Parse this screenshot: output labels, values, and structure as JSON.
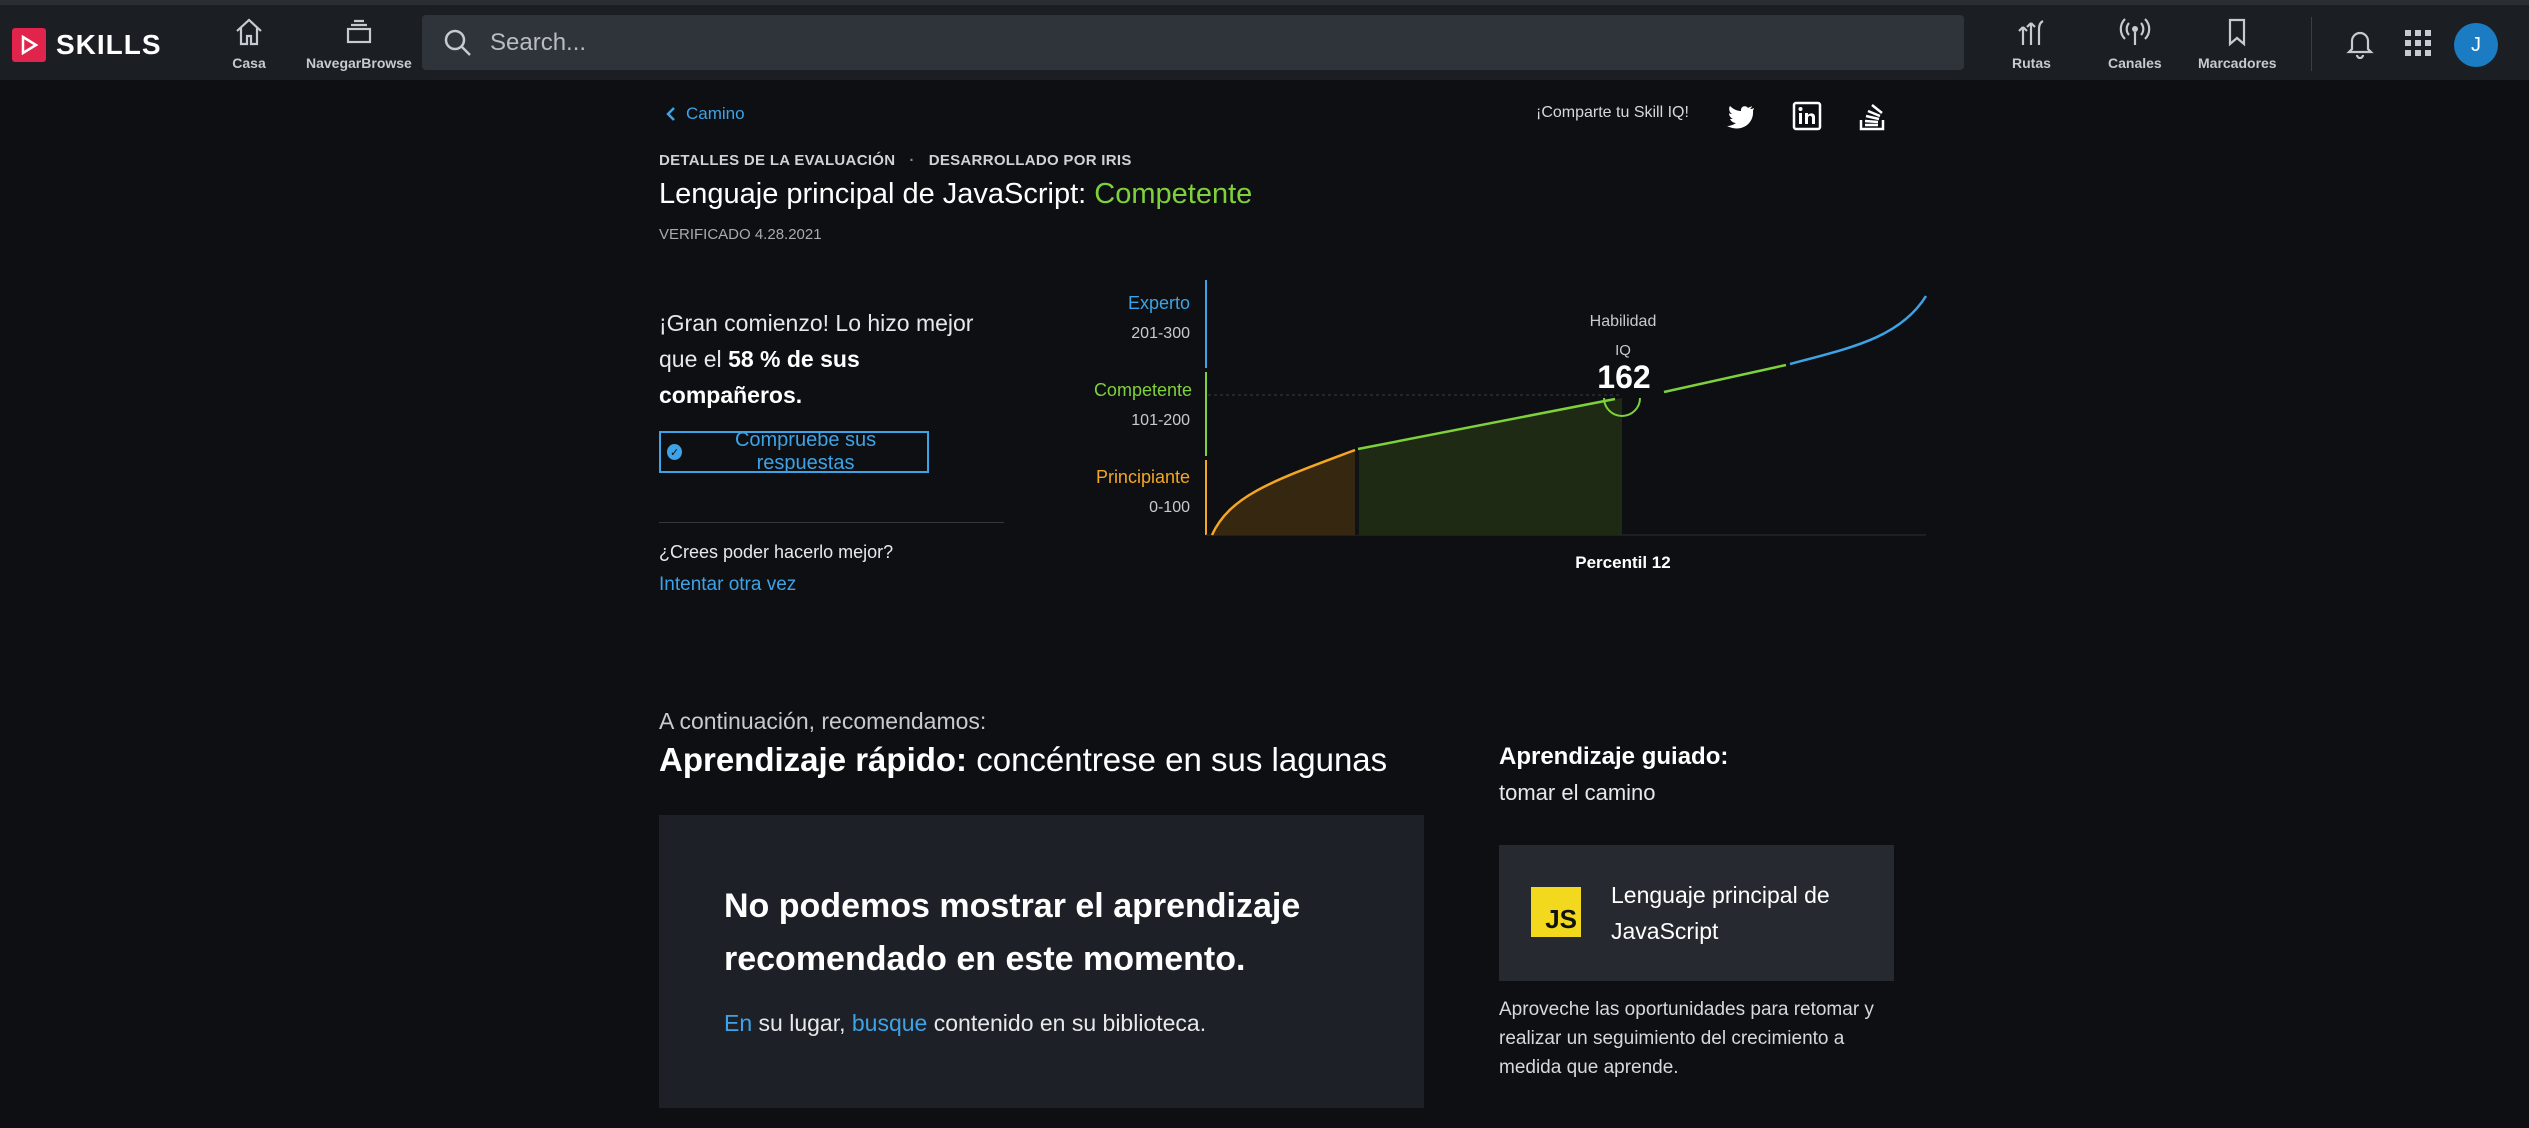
{
  "header": {
    "brand": "SKILLS",
    "nav": [
      {
        "label": "Casa",
        "icon": "home-icon"
      },
      {
        "label": "NavegarBrowse",
        "icon": "browse-icon"
      }
    ],
    "search_placeholder": "Search...",
    "right_nav": [
      {
        "label": "Rutas",
        "icon": "paths-icon"
      },
      {
        "label": "Canales",
        "icon": "channels-icon"
      },
      {
        "label": "Marcadores",
        "icon": "bookmark-icon"
      }
    ],
    "avatar_initial": "J"
  },
  "breadcrumb": {
    "back_label": "Camino"
  },
  "share": {
    "label": "¡Comparte tu Skill IQ!",
    "icons": [
      "twitter-icon",
      "linkedin-icon",
      "stackoverflow-icon"
    ]
  },
  "assessment": {
    "meta_left": "DETALLES DE LA EVALUACIÓN",
    "meta_sep": "·",
    "meta_right": "DESARROLLADO POR IRIS",
    "title_prefix": "Lenguaje principal de JavaScript:",
    "level": "Competente",
    "verified": "VERIFICADO 4.28.2021"
  },
  "result": {
    "line1": "¡Gran comienzo! Lo hizo mejor que el ",
    "percent": "58 % de sus compañeros.",
    "check_answers": "Compruebe sus respuestas",
    "better_question": "¿Crees poder hacerlo mejor?",
    "retry": "Intentar otra vez"
  },
  "chart_data": {
    "type": "area",
    "levels": [
      {
        "name": "Experto",
        "range": "201-300",
        "color": "#3ea3e6"
      },
      {
        "name": "Competente",
        "range": "101-200",
        "color": "#7fd13b"
      },
      {
        "name": "Principiante",
        "range": "0-100",
        "color": "#f5a623"
      }
    ],
    "marker_label_1": "Habilidad",
    "marker_label_2": "IQ",
    "score": "162",
    "percentile_label": "Percentil 12",
    "ylim": [
      0,
      300
    ]
  },
  "recommendations": {
    "pre": "A continuación, recomendamos:",
    "title_bold": "Aprendizaje rápido:",
    "title_rest": " concéntrese en sus lagunas",
    "message": "No podemos mostrar el aprendizaje recomendado en este momento.",
    "sub_link1": "En",
    "sub_mid": " su lugar, ",
    "sub_link2": "busque",
    "sub_end": " contenido en su biblioteca."
  },
  "guided": {
    "heading": "Aprendizaje guiado:",
    "sub": "tomar el camino",
    "logo_text": "JS",
    "course": "Lenguaje principal de JavaScript",
    "description": "Aproveche las oportunidades para retomar y realizar un seguimiento del crecimiento a medida que aprende."
  }
}
